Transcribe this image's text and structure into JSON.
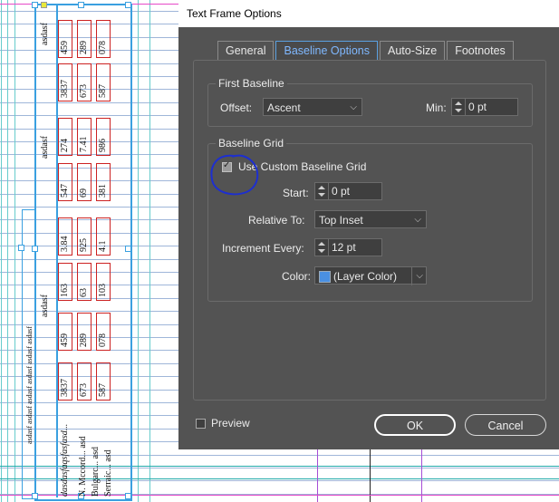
{
  "dialog": {
    "title": "Text Frame Options",
    "tabs": [
      {
        "label": "General",
        "active": false
      },
      {
        "label": "Baseline Options",
        "active": true
      },
      {
        "label": "Auto-Size",
        "active": false
      },
      {
        "label": "Footnotes",
        "active": false
      }
    ],
    "first_baseline": {
      "group_label": "First Baseline",
      "offset_label": "Offset:",
      "offset_value": "Ascent",
      "min_label": "Min:",
      "min_value": "0 pt"
    },
    "baseline_grid": {
      "group_label": "Baseline Grid",
      "use_custom_label": "Use Custom Baseline Grid",
      "use_custom_checked": true,
      "start_label": "Start:",
      "start_value": "0 pt",
      "relative_to_label": "Relative To:",
      "relative_to_value": "Top Inset",
      "increment_label": "Increment Every:",
      "increment_value": "12 pt",
      "color_label": "Color:",
      "color_value": "(Layer Color)",
      "color_swatch": "#4a90e2"
    },
    "preview_label": "Preview",
    "preview_checked": false,
    "ok_label": "OK",
    "cancel_label": "Cancel"
  },
  "document": {
    "vertical_text": [
      {
        "text": "asdasf"
      },
      {
        "text": "asdasf"
      },
      {
        "text": "asdasf"
      },
      {
        "text": "asdasf asdasf asdasf asdasf asdasf asdasf"
      },
      {
        "text": "dasdasfaqsfasfasd..."
      },
      {
        "text": "N. Mccord... asd"
      },
      {
        "text": "Bulgarc... asd"
      },
      {
        "text": "Serraic... asd"
      }
    ],
    "cell_numbers": [
      "459",
      "289",
      "078",
      "3837",
      "673",
      "587",
      "274",
      "7.41",
      "986",
      "547",
      "69",
      "381",
      "3.84",
      "925",
      "4.1",
      "163",
      "63",
      "103"
    ]
  },
  "colors": {
    "dialog_bg": "#535353",
    "accent_tab": "#7fb8ff",
    "grid_line": "#9fb6d9",
    "frame_line": "#3aa0e0",
    "annotation": "#1d2fd0"
  }
}
